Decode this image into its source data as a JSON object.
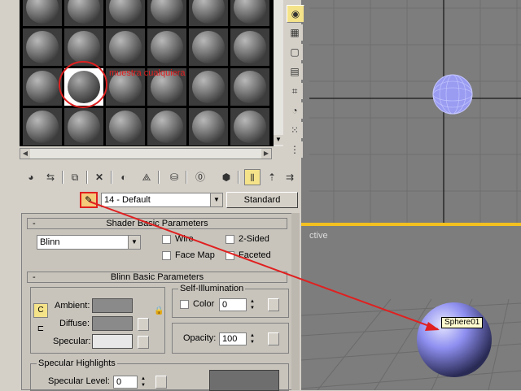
{
  "annotation": {
    "label": "muestra cualquiera",
    "color": "#e02020"
  },
  "material": {
    "name": "14 - Default",
    "type_button": "Standard"
  },
  "shader_basic": {
    "title": "Shader Basic Parameters",
    "collapse": "-",
    "shader": "Blinn",
    "options": [
      "Wire",
      "2-Sided",
      "Face Map",
      "Faceted"
    ]
  },
  "blinn_basic": {
    "title": "Blinn Basic Parameters",
    "collapse": "-",
    "ambient_label": "Ambient:",
    "diffuse_label": "Diffuse:",
    "specular_label": "Specular:",
    "self_illum_title": "Self-Illumination",
    "color_label": "Color",
    "color_value": "0",
    "opacity_label": "Opacity:",
    "opacity_value": "100"
  },
  "specular_highlights": {
    "title": "Specular Highlights",
    "level_label": "Specular Level:",
    "level_value": "0"
  },
  "viewport": {
    "active_text": "ctive",
    "object_label": "Sphere01",
    "highlight_color": "#f3c020"
  },
  "colors": {
    "ui_bg": "#d4d0c8",
    "viewport_bg": "#7d7d7d",
    "sphere_blue": "#8e8ff0"
  }
}
